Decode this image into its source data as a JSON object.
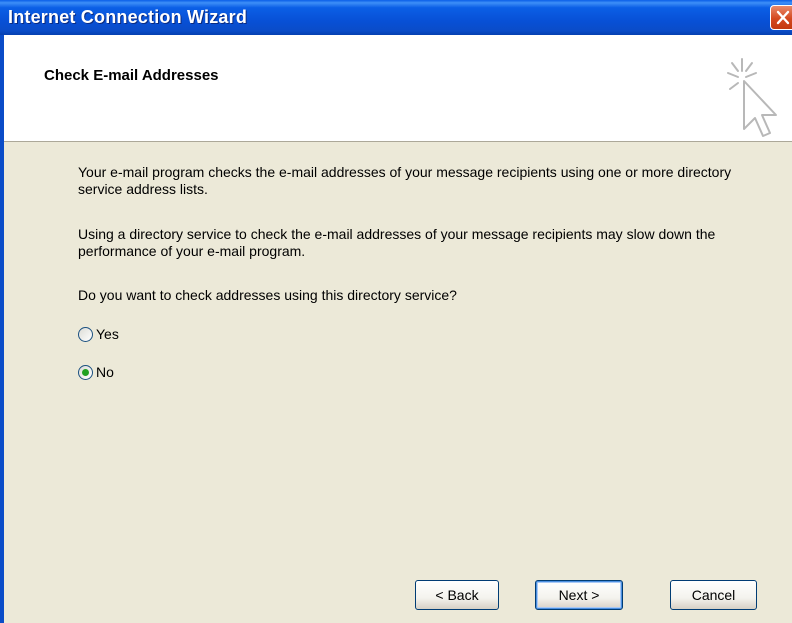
{
  "window": {
    "title": "Internet Connection Wizard",
    "close_icon": "close-icon"
  },
  "header": {
    "title": "Check E-mail Addresses",
    "icon": "wizard-cursor-icon"
  },
  "content": {
    "paragraph1": "Your e-mail program checks the e-mail addresses of your message recipients using one or more directory service address lists.",
    "paragraph2": "Using a directory service to check the e-mail addresses of your message recipients may slow down the performance of your e-mail program.",
    "question": "Do you want to check addresses using this directory service?",
    "options": [
      {
        "label": "Yes",
        "selected": false
      },
      {
        "label": "No",
        "selected": true
      }
    ]
  },
  "buttons": {
    "back": "< Back",
    "next": "Next >",
    "cancel": "Cancel"
  },
  "colors": {
    "titlebar": "#0a4cc8",
    "dialog_bg": "#ece9d8",
    "header_bg": "#ffffff",
    "radio_dot": "#21a121",
    "close_button": "#d4481f"
  }
}
